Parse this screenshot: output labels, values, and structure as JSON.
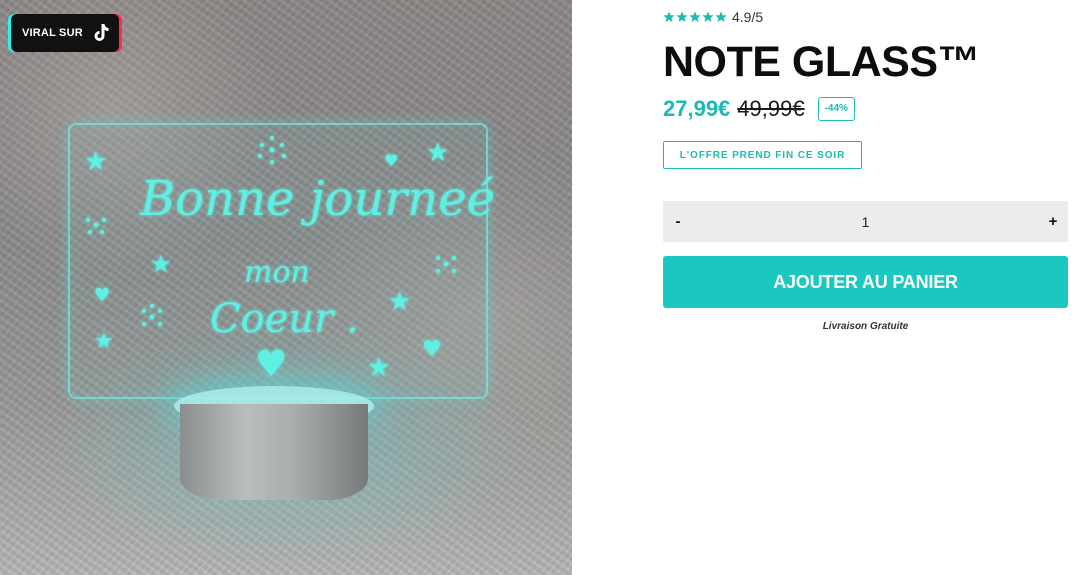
{
  "media": {
    "image_name": "note-glass-product-photo",
    "handwriting_line1": "Bonne journeé",
    "handwriting_line2": "mon",
    "handwriting_line3": "Coeur .",
    "viral_badge_label": "VIRAL SUR",
    "viral_badge_icon": "tiktok-icon"
  },
  "product": {
    "rating_stars": 5,
    "rating_text": "4.9/5",
    "title": "NOTE GLASS™",
    "price_current": "27,99€",
    "price_old": "49,99€",
    "discount": "-44%",
    "offer_text": "L'OFFRE PREND FIN CE SOIR"
  },
  "quantity": {
    "minus_label": "-",
    "value": "1",
    "plus_label": "+"
  },
  "cart": {
    "add_button_label": "AJOUTER AU PANIER",
    "shipping_note": "Livraison Gratuite"
  },
  "colors": {
    "accent": "#1bc8bf",
    "price": "#1bbbb3",
    "title": "#0d0d0d"
  }
}
